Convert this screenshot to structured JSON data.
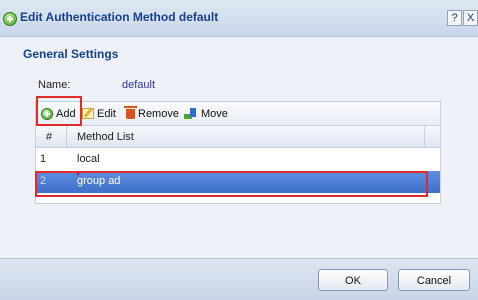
{
  "dialog": {
    "title": "Edit Authentication Method default",
    "help_label": "?",
    "close_label": "X"
  },
  "general": {
    "section_title": "General Settings",
    "name_label": "Name:",
    "name_value": "default"
  },
  "toolbar": {
    "add_label": "Add",
    "edit_label": "Edit",
    "remove_label": "Remove",
    "move_label": "Move"
  },
  "table": {
    "columns": [
      "#",
      "Method List"
    ],
    "rows": [
      {
        "num": "1",
        "method": "local",
        "selected": false
      },
      {
        "num": "2",
        "method": "group ad",
        "selected": true
      }
    ]
  },
  "footer": {
    "ok_label": "OK",
    "cancel_label": "Cancel"
  },
  "colors": {
    "title_text": "#15428b",
    "selection": "#3f6fc9",
    "highlight_box": "#e12a2a"
  }
}
